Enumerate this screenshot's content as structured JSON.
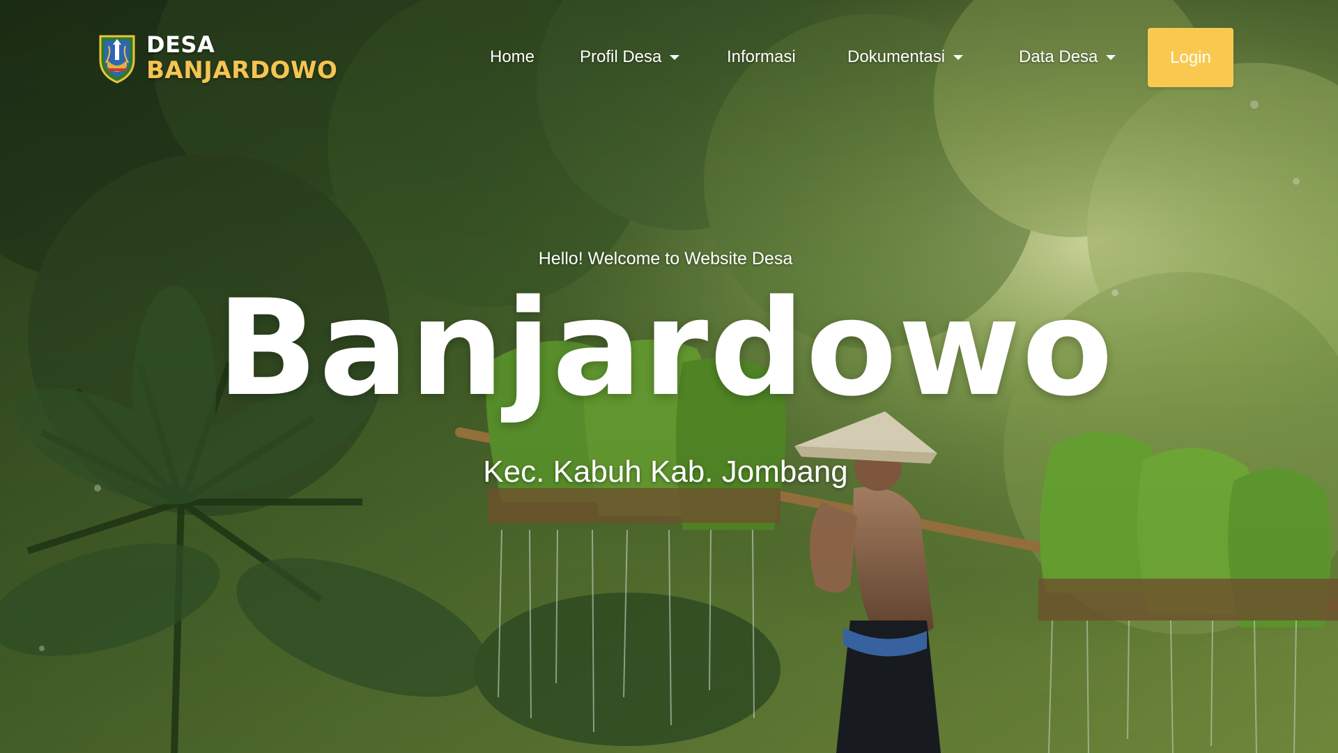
{
  "brand": {
    "line1": "DESA",
    "line2": "BANJARDOWO",
    "logo_icon": "shield-emblem-icon"
  },
  "nav": {
    "items": [
      {
        "label": "Home",
        "has_dropdown": false
      },
      {
        "label": "Profil Desa",
        "has_dropdown": true
      },
      {
        "label": "Informasi",
        "has_dropdown": false
      },
      {
        "label": "Dokumentasi",
        "has_dropdown": true
      },
      {
        "label": "Data Desa",
        "has_dropdown": true
      }
    ],
    "login_label": "Login"
  },
  "hero": {
    "greeting": "Hello! Welcome to Website Desa",
    "title": "Banjardowo",
    "subtitle": "Kec. Kabuh Kab. Jombang"
  },
  "colors": {
    "accent": "#f9c94f",
    "brand_highlight": "#f5c451",
    "text": "#ffffff"
  }
}
